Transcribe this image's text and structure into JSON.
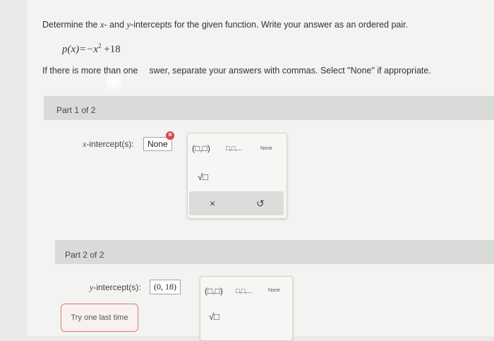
{
  "question": {
    "text_a": "Determine the ",
    "x_var": "x",
    "text_b": "- and ",
    "y_var": "y",
    "text_c": "-intercepts for the given function. Write your answer as an ordered pair.",
    "equation_lhs": "p(x)=−x",
    "equation_exp": "2",
    "equation_rhs": " +18",
    "note_a": "If there is more than one",
    "note_b": "swer, separate your answers with commas. Select \"None\" if appropriate."
  },
  "part1": {
    "label": "Part 1 of 2",
    "x_label_var": "x",
    "x_label_rest": "-intercept(s):",
    "answer": "None",
    "error_icon": "×",
    "keypad": {
      "ordered_pair": "(□,□)",
      "list": "□,□,...",
      "none": "None",
      "sqrt": "√□",
      "clear": "×",
      "undo": "↺"
    }
  },
  "part2": {
    "label": "Part 2 of 2",
    "y_label_var": "y",
    "y_label_rest": "-intercept(s):",
    "answer": "(0, 18)",
    "keypad": {
      "ordered_pair": "(□,□)",
      "list": "□,□,...",
      "none": "None",
      "sqrt": "√□"
    }
  },
  "try_button": "Try one last time"
}
